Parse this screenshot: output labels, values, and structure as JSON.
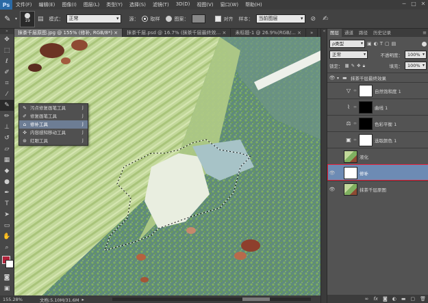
{
  "app": {
    "logo": "Ps"
  },
  "menu": [
    "文件(F)",
    "编辑(E)",
    "图像(I)",
    "图层(L)",
    "类型(Y)",
    "选择(S)",
    "滤镜(T)",
    "3D(D)",
    "视图(V)",
    "窗口(W)",
    "帮助(H)"
  ],
  "window_controls": [
    "─",
    "□",
    "✕"
  ],
  "options": {
    "brush_size": "19",
    "mode_label": "模式：",
    "mode_value": "正常",
    "source_label": "源：",
    "sampled_label": "取样",
    "pattern_label": "图案：",
    "aligned_label": "对齐",
    "sample_label": "样本：",
    "sample_value": "当前图层"
  },
  "tabs": [
    {
      "label": "抹茶千层原图.jpg @ 155% (修补, RGB/8*) ×",
      "active": true
    },
    {
      "label": "抹茶千层.psd @ 16.7% (抹茶千层最终效... ×",
      "active": false
    },
    {
      "label": "未标题-1 @ 26.9%(RGB/... ×",
      "active": false
    },
    {
      "label": "»",
      "active": false
    }
  ],
  "flyout": [
    {
      "icon": "spot-healing-icon",
      "glyph": "✎",
      "label": "污点修复画笔工具",
      "key": "J",
      "selected": false
    },
    {
      "icon": "healing-brush-icon",
      "glyph": "✐",
      "label": "修复画笔工具",
      "key": "J",
      "selected": false
    },
    {
      "icon": "patch-icon",
      "glyph": "⌂",
      "label": "修补工具",
      "key": "J",
      "selected": true
    },
    {
      "icon": "content-aware-move-icon",
      "glyph": "✜",
      "label": "内容感知移动工具",
      "key": "J",
      "selected": false
    },
    {
      "icon": "red-eye-icon",
      "glyph": "⊛",
      "label": "红眼工具",
      "key": "J",
      "selected": false
    }
  ],
  "status": {
    "zoom": "155.28%",
    "doc": "文档:5.10M/31.6M"
  },
  "panel": {
    "tabs": [
      "图层",
      "通道",
      "路径",
      "历史记录"
    ],
    "filter_type": "ρ类型",
    "blend_mode": "正常",
    "opacity_label": "不透明度：",
    "opacity_value": "100%",
    "lock_label": "锁定：",
    "fill_label": "填充：",
    "fill_value": "100%",
    "group_name": "抹茶千层最终效果",
    "layers": [
      {
        "name": "自然饱和度 1",
        "kind": "adjustment",
        "glyph": "▽",
        "mask": "white",
        "visible": false
      },
      {
        "name": "曲线 1",
        "kind": "adjustment",
        "glyph": "⌇",
        "mask": "black",
        "visible": false
      },
      {
        "name": "色彩平衡 1",
        "kind": "adjustment",
        "glyph": "⚖",
        "mask": "black",
        "visible": false
      },
      {
        "name": "选取颜色 1",
        "kind": "adjustment",
        "glyph": "▣",
        "mask": "white",
        "visible": false
      },
      {
        "name": "液化",
        "kind": "image",
        "visible": false
      },
      {
        "name": "修补",
        "kind": "blank",
        "visible": true,
        "selected": true
      },
      {
        "name": "抹茶千层原图",
        "kind": "image",
        "visible": true
      }
    ],
    "footer_icons": [
      "link-icon",
      "fx-icon",
      "mask-icon",
      "adjust-icon",
      "folder-icon",
      "new-layer-icon",
      "trash-icon"
    ]
  },
  "colors": {
    "accent": "#e8213b",
    "selected_layer": "#6d8bb4",
    "swatch_fg": "#b0223a",
    "swatch_bg": "#ffffff"
  }
}
